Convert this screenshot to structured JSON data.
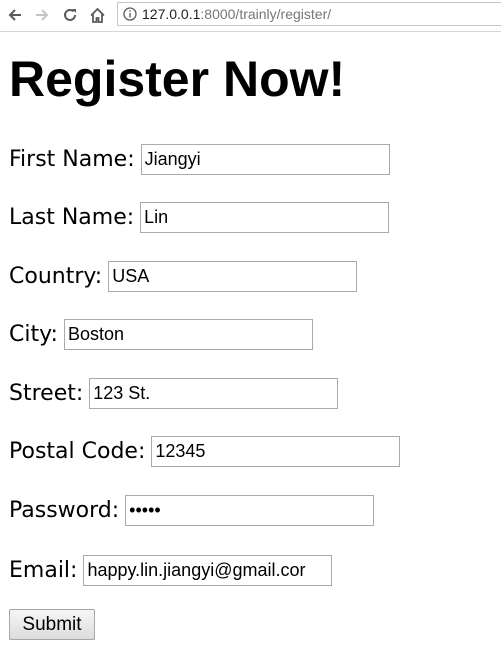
{
  "browser": {
    "url_host": "127.0.0.1",
    "url_path": ":8000/trainly/register/"
  },
  "page": {
    "title": "Register Now!"
  },
  "form": {
    "fields": [
      {
        "label": "First Name:",
        "value": "Jiangyi"
      },
      {
        "label": "Last Name:",
        "value": "Lin"
      },
      {
        "label": "Country:",
        "value": "USA"
      },
      {
        "label": "City:",
        "value": "Boston"
      },
      {
        "label": "Street:",
        "value": "123 St."
      },
      {
        "label": "Postal Code:",
        "value": "12345"
      },
      {
        "label": "Password:",
        "value": "•••••"
      },
      {
        "label": "Email:",
        "value": "happy.lin.jiangyi@gmail.cor"
      }
    ],
    "submit_label": "Submit"
  }
}
